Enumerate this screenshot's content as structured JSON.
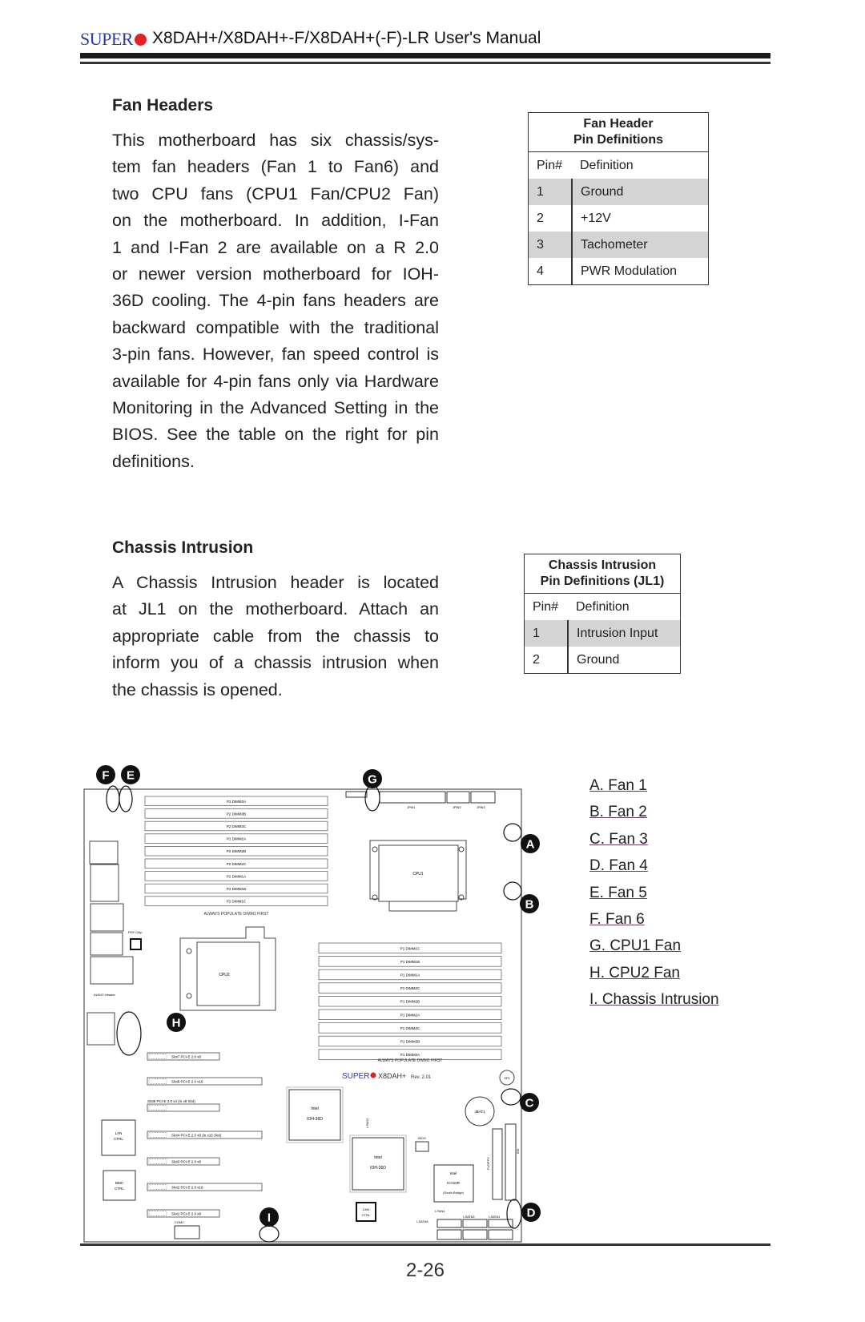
{
  "header": {
    "logo": "SUPERMICRO",
    "logo_display": "SUPER",
    "title": "X8DAH+/X8DAH+-F/X8DAH+(-F)-LR User's Manual"
  },
  "fan_headers": {
    "heading": "Fan Headers",
    "lines": [
      "This motherboard has six chassis/sys-",
      "tem fan headers (Fan 1 to Fan6) and",
      "two CPU fans (CPU1 Fan/CPU2 Fan)",
      "on the motherboard. In addition, I-Fan",
      "1 and I-Fan 2 are available on a R 2.0",
      "or newer version motherboard for IOH-",
      "36D cooling. The 4-pin fans headers are",
      "backward compatible with the traditional",
      "3-pin fans. However, fan speed control is",
      "available for 4-pin fans only via Hardware",
      "Monitoring in the Advanced Setting in the",
      "BIOS. See the table on the right for pin",
      "definitions."
    ],
    "table": {
      "title_1": "Fan Header",
      "title_2": "Pin Definitions",
      "columns": [
        "Pin#",
        "Definition"
      ],
      "rows": [
        [
          "1",
          "Ground"
        ],
        [
          "2",
          "+12V"
        ],
        [
          "3",
          "Tachometer"
        ],
        [
          "4",
          "PWR Modulation"
        ]
      ]
    }
  },
  "chassis_intrusion": {
    "heading": "Chassis Intrusion",
    "lines": [
      "A Chassis Intrusion header is located",
      "at JL1 on the motherboard. Attach an",
      "appropriate cable from the chassis to",
      "inform you of a chassis intrusion when",
      "the chassis is opened."
    ],
    "table": {
      "title_1": "Chassis Intrusion",
      "title_2": "Pin Definitions (JL1)",
      "columns": [
        "Pin#",
        "Definition"
      ],
      "rows": [
        [
          "1",
          "Intrusion Input"
        ],
        [
          "2",
          "Ground"
        ]
      ]
    }
  },
  "diagram": {
    "markers": [
      "A",
      "B",
      "C",
      "D",
      "E",
      "F",
      "G",
      "H",
      "I"
    ],
    "marker_color": "#111111",
    "p2_dimms": [
      "P2 DIMM3A",
      "P2 DIMM3B",
      "P2 DIMM3C",
      "P2 DIMM2A",
      "P2 DIMM2B",
      "P2 DIMM2C",
      "P2 DIMM1A",
      "P2 DIMM1B",
      "P2 DIMM1C"
    ],
    "p1_dimms": [
      "P1 DIMM1C",
      "P1 DIMM1B",
      "P1 DIMM1A",
      "P1 DIMM2C",
      "P1 DIMM2B",
      "P1 DIMM2A",
      "P1 DIMM3C",
      "P1 DIMM3B",
      "P1 DIMM3A"
    ],
    "populate_note": "ALWAYS POPULATE DIMM1 FIRST",
    "cpu1": "CPU1",
    "cpu2": "CPU2",
    "slots": [
      "Slot7 PCI-E 2.0 x8",
      "Slot6 PCI-E 2.0 x16",
      "Slot5 PCI-E 2.0 x4 (in x8 Slot)",
      "Slot4 PCI-E 2.0 x8 (in x16 Slot)",
      "Slot3 PCI-E 2.0 x8",
      "Slot2 PCI-E 2.0 x16",
      "Slot1 PCI-E 2.0 x8"
    ],
    "ioh_vendor": "Intel",
    "ioh": "IOH-36D",
    "ich": "ICH10R",
    "ich_sub": "(South Bridge)",
    "board_brand": "SUPER",
    "board_model": "X8DAH+",
    "board_rev": "Rev. 2.01",
    "jbat": "JBAT1",
    "lan_ctrl": [
      "LAN",
      "CTRL"
    ],
    "bmc_ctrl": [
      "BMC",
      "CTRL"
    ],
    "ctrl_1394": [
      "1394",
      "CTRL"
    ],
    "bios": "BIOS",
    "floppy": "FLOPPY",
    "ide": "IDE",
    "jpw": [
      "JPW1",
      "JPW2",
      "JPW3"
    ],
    "com2": "COM2",
    "audio": "AUDIO Header",
    "phy": "PHY Chip",
    "ifan1": "I-FAN1",
    "ifan2": "I-FAN2",
    "sp1": "SP1",
    "sata": [
      "I-SATA5",
      "I-SATA3",
      "I-SATA1"
    ]
  },
  "legend": [
    "A. Fan 1",
    "B. Fan 2",
    "C. Fan 3",
    "D. Fan 4",
    "E. Fan 5",
    "F. Fan 6",
    "G. CPU1 Fan",
    "H. CPU2 Fan",
    "I. Chassis Intrusion"
  ],
  "footer": {
    "page_number": "2-26"
  }
}
